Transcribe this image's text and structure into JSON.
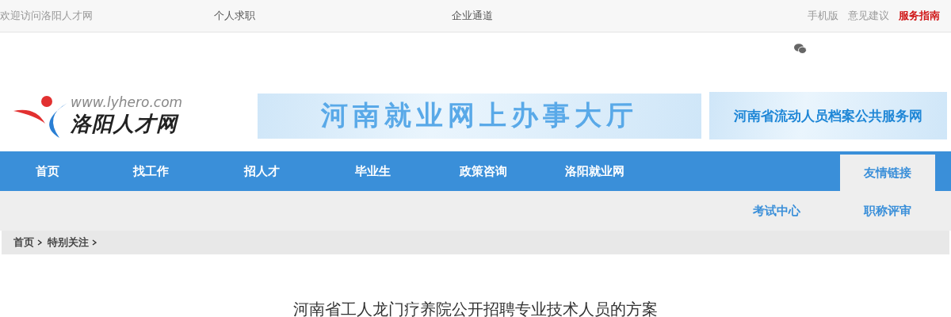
{
  "top_bar": {
    "welcome": "欢迎访问洛阳人才网",
    "channels": [
      "个人求职",
      "企业通道"
    ],
    "links": [
      {
        "label": "手机版",
        "kind": "plain"
      },
      {
        "label": "意见建议",
        "kind": "plain"
      },
      {
        "label": "服务指南",
        "kind": "highlight"
      }
    ]
  },
  "header": {
    "logo": {
      "url": "www.lyhero.com",
      "name": "洛阳人才网"
    },
    "banners": [
      {
        "text": "河南就业网上办事大厅",
        "kind": "wide"
      },
      {
        "text": "河南省流动人员档案公共服务网",
        "kind": "narrow"
      }
    ]
  },
  "nav": {
    "items": [
      {
        "label": "首页",
        "selected": false
      },
      {
        "label": "找工作",
        "selected": false
      },
      {
        "label": "招人才",
        "selected": false
      },
      {
        "label": "毕业生",
        "selected": false
      },
      {
        "label": "政策咨询",
        "selected": false
      },
      {
        "label": "洛阳就业网",
        "selected": false
      },
      {
        "label": "友情链接",
        "selected": true
      }
    ],
    "sub_items": [
      "考试中心",
      "职称评审"
    ]
  },
  "breadcrumb": [
    "首页",
    "特别关注"
  ],
  "article": {
    "title": "河南省工人龙门疗养院公开招聘专业技术人员的方案"
  }
}
